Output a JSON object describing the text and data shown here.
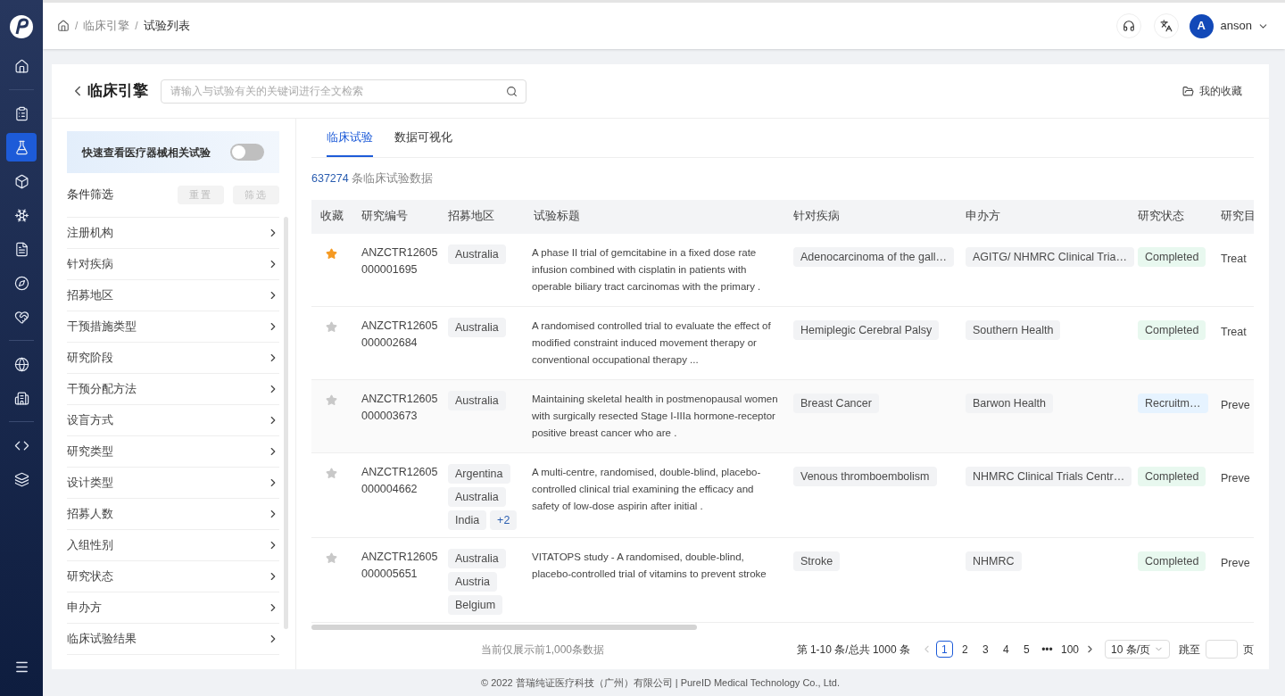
{
  "nav": [
    {
      "selected": false
    },
    {
      "selected": false
    },
    {
      "selected": true
    },
    {
      "selected": false
    },
    {
      "selected": false
    },
    {
      "selected": false
    },
    {
      "selected": false
    },
    {
      "selected": false
    },
    {
      "selected": false
    },
    {
      "selected": false
    },
    {
      "selected": false
    },
    {
      "selected": false
    }
  ],
  "breadcrumb": [
    "临床引擎",
    "试验列表"
  ],
  "breadcrumb_separator": "/",
  "user": {
    "initial": "A",
    "name": "anson"
  },
  "page_title": "临床引擎",
  "search": {
    "placeholder": "请输入与试验有关的关键词进行全文检索"
  },
  "favorites_link": "我的收藏",
  "device_toggle": {
    "label": "快速查看医疗器械相关试验",
    "on": false
  },
  "filters": {
    "title": "条件筛选",
    "buttons": [
      {
        "label": "重置",
        "disabled": true
      },
      {
        "label": "筛选",
        "disabled": true
      }
    ],
    "items": [
      "注册机构",
      "针对疾病",
      "招募地区",
      "干预措施类型",
      "研究阶段",
      "干预分配方法",
      "设盲方式",
      "研究类型",
      "设计类型",
      "招募人数",
      "入组性别",
      "研究状态",
      "申办方",
      "临床试验结果"
    ]
  },
  "tabs": [
    {
      "label": "临床试验",
      "selected": true
    },
    {
      "label": "数据可视化",
      "selected": false
    }
  ],
  "count": {
    "number": "637274",
    "text": "条临床试验数据"
  },
  "table": {
    "columns": [
      "收藏",
      "研究编号",
      "招募地区",
      "试验标题",
      "针对疾病",
      "申办方",
      "研究状态",
      "研究目"
    ],
    "rows": [
      {
        "favorite": true,
        "id": [
          "ANZCTR12605",
          "000001695"
        ],
        "regions": [
          "Australia"
        ],
        "title": "A phase II trial of gemcitabine in a fixed dose rate infusion combined with cisplatin in patients with operable biliary tract carcinomas with the primary .",
        "disease": "Adenocarcinoma of the gall…",
        "sponsor": "AGITG/ NHMRC Clinical Tria…",
        "status": {
          "label": "Completed",
          "color": "#e8f8ef"
        },
        "column_8": "Treat"
      },
      {
        "favorite": false,
        "id": [
          "ANZCTR12605",
          "000002684"
        ],
        "regions": [
          "Australia"
        ],
        "title": "A randomised controlled trial to evaluate the effect of modified constraint induced movement therapy or conventional occupational therapy ...",
        "disease": "Hemiplegic Cerebral Palsy",
        "sponsor": "Southern Health",
        "status": {
          "label": "Completed",
          "color": "#e8f8ef"
        },
        "column_8": "Treat"
      },
      {
        "favorite": false,
        "id": [
          "ANZCTR12605",
          "000003673"
        ],
        "regions": [
          "Australia"
        ],
        "title": "Maintaining skeletal health in postmenopausal women with surgically resected Stage I-IIIa hormone-receptor positive breast cancer who are .",
        "disease": "Breast Cancer",
        "sponsor": "Barwon Health",
        "status": {
          "label": "Recruitm…",
          "color": "#e6f3ff"
        },
        "column_8": "Preve"
      },
      {
        "favorite": false,
        "id": [
          "ANZCTR12605",
          "000004662"
        ],
        "regions": [
          "Argentina",
          "Australia",
          "India"
        ],
        "more": "+2",
        "title": "A multi-centre, randomised, double-blind, placebo-controlled clinical trial examining the efficacy and safety of low-dose aspirin after initial .",
        "disease": "Venous thromboembolism",
        "sponsor": "NHMRC Clinical Trials Centr…",
        "status": {
          "label": "Completed",
          "color": "#e8f8ef"
        },
        "column_8": "Preve"
      },
      {
        "favorite": false,
        "id": [
          "ANZCTR12605",
          "000005651"
        ],
        "regions": [
          "Australia",
          "Austria",
          "Belgium"
        ],
        "title": "VITATOPS study - A randomised, double-blind, placebo-controlled trial of vitamins to prevent stroke",
        "disease": "Stroke",
        "sponsor": "NHMRC",
        "status": {
          "label": "Completed",
          "color": "#e8f8ef"
        },
        "column_8": "Preve"
      }
    ]
  },
  "notice": "当前仅展示前1,000条数据",
  "pagination": {
    "summary": "第 1-10 条/总共 1000 条",
    "pages": [
      {
        "label": "1",
        "selected": true
      },
      {
        "label": "2",
        "selected": false
      },
      {
        "label": "3",
        "selected": false
      },
      {
        "label": "4",
        "selected": false
      },
      {
        "label": "5",
        "selected": false
      },
      {
        "label": "•••",
        "selected": false
      },
      {
        "label": "100",
        "selected": false
      }
    ],
    "page_size": "10 条/页",
    "jump_label": "跳至",
    "jump_suffix": "页"
  },
  "footer": "© 2022 普瑞纯证医疗科技（广州）有限公司 | PureID Medical Technology Co., Ltd."
}
